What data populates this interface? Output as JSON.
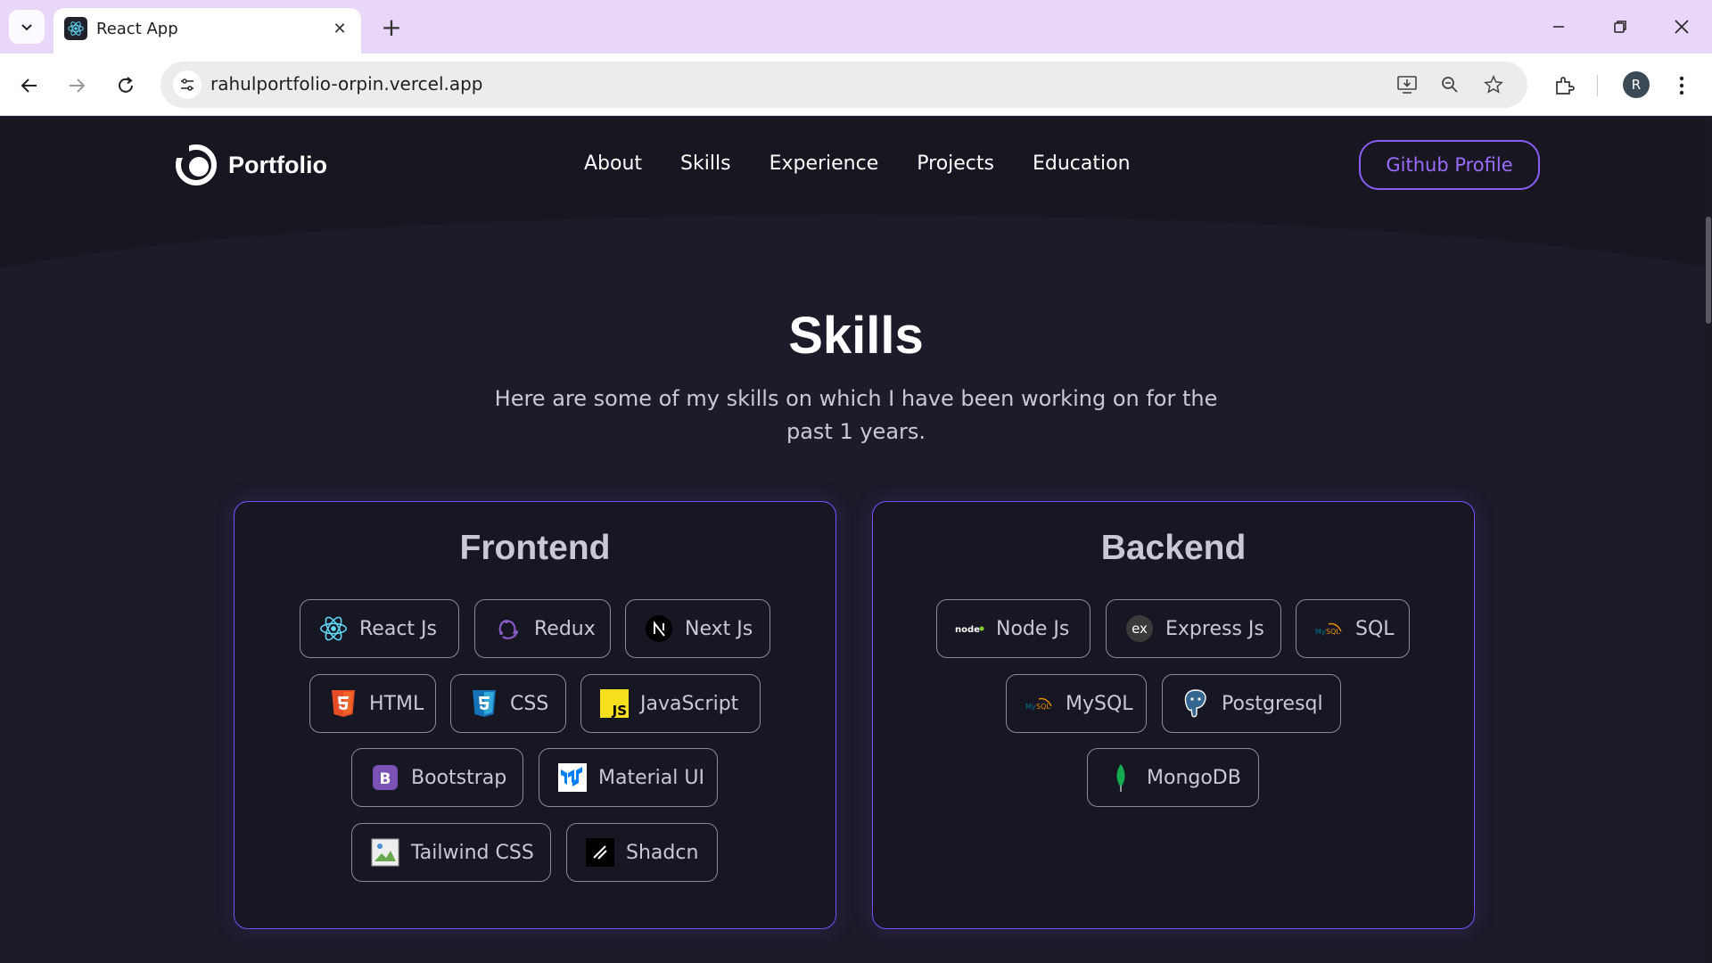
{
  "browser": {
    "tab_title": "React App",
    "url": "rahulportfolio-orpin.vercel.app",
    "profile_initial": "R"
  },
  "site": {
    "logo_text": "Portfolio",
    "nav": [
      "About",
      "Skills",
      "Experience",
      "Projects",
      "Education"
    ],
    "github_button": "Github Profile"
  },
  "skills": {
    "title": "Skills",
    "description": "Here are some of my skills on which I have been working on for the past 1 years.",
    "categories": [
      {
        "title": "Frontend",
        "items": [
          {
            "label": "React Js",
            "icon": "react-icon"
          },
          {
            "label": "Redux",
            "icon": "redux-icon"
          },
          {
            "label": "Next Js",
            "icon": "nextjs-icon"
          },
          {
            "label": "HTML",
            "icon": "html5-icon"
          },
          {
            "label": "CSS",
            "icon": "css3-icon"
          },
          {
            "label": "JavaScript",
            "icon": "javascript-icon"
          },
          {
            "label": "Bootstrap",
            "icon": "bootstrap-icon"
          },
          {
            "label": "Material UI",
            "icon": "material-ui-icon"
          },
          {
            "label": "Tailwind CSS",
            "icon": "broken-image-icon"
          },
          {
            "label": "Shadcn",
            "icon": "shadcn-icon"
          }
        ]
      },
      {
        "title": "Backend",
        "items": [
          {
            "label": "Node Js",
            "icon": "nodejs-icon"
          },
          {
            "label": "Express Js",
            "icon": "express-icon"
          },
          {
            "label": "SQL",
            "icon": "mysql-icon"
          },
          {
            "label": "MySQL",
            "icon": "mysql-icon"
          },
          {
            "label": "Postgresql",
            "icon": "postgresql-icon"
          },
          {
            "label": "MongoDB",
            "icon": "mongodb-icon"
          }
        ]
      }
    ]
  },
  "colors": {
    "page_bg": "#1c1b29",
    "accent": "#8b5cf6",
    "text_muted": "#c9c9d6",
    "browser_tabbar": "#e8d7f8"
  }
}
